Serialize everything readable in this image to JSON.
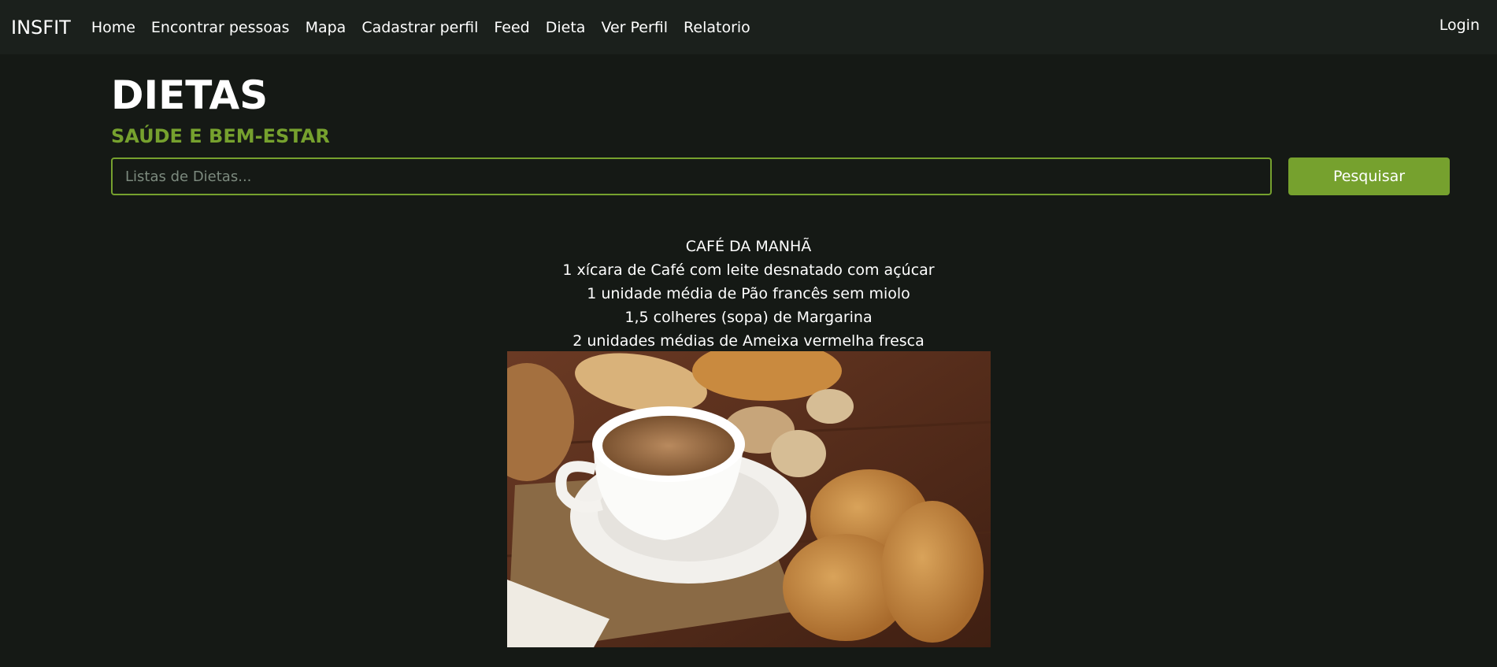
{
  "navbar": {
    "brand": "INSFIT",
    "links": [
      "Home",
      "Encontrar pessoas",
      "Mapa",
      "Cadastrar perfil",
      "Feed",
      "Dieta",
      "Ver Perfil",
      "Relatorio"
    ],
    "login": "Login"
  },
  "header": {
    "title": "DIETAS",
    "subtitle": "SAÚDE E BEM-ESTAR"
  },
  "search": {
    "placeholder": "Listas de Dietas...",
    "value": "",
    "button_label": "Pesquisar"
  },
  "meal": {
    "title": "CAFÉ DA MANHÃ",
    "items": [
      "1 xícara de Café com leite desnatado com açúcar",
      "1 unidade média de Pão francês sem miolo",
      "1,5 colheres (sopa) de Margarina",
      "2 unidades médias de Ameixa vermelha fresca"
    ]
  },
  "colors": {
    "background": "#151915",
    "navbar": "#1b201c",
    "accent": "#76a12e"
  }
}
